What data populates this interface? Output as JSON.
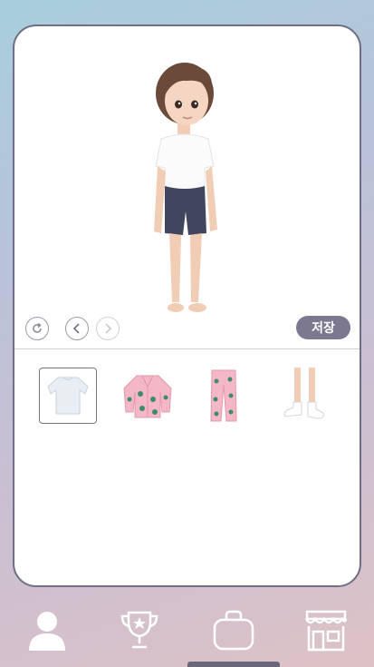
{
  "editor": {
    "save_label": "저장"
  },
  "controls": {
    "rotate": "rotate-icon",
    "prev": "chevron-left-icon",
    "next": "chevron-right-icon"
  },
  "clothing_items": [
    {
      "icon": "white-long-sleeve-shirt-icon",
      "selected": true
    },
    {
      "icon": "pink-pajama-top-icon",
      "selected": false
    },
    {
      "icon": "pink-pajama-pants-icon",
      "selected": false
    },
    {
      "icon": "white-socks-icon",
      "selected": false
    }
  ],
  "tabs": [
    {
      "icon": "avatar-person-icon",
      "active": true
    },
    {
      "icon": "trophy-icon",
      "active": false
    },
    {
      "icon": "bag-icon",
      "active": false
    },
    {
      "icon": "store-icon",
      "active": false
    }
  ],
  "colors": {
    "accent": "#7c7890",
    "border": "#6f6e86",
    "tab_icon": "#ffffff"
  }
}
